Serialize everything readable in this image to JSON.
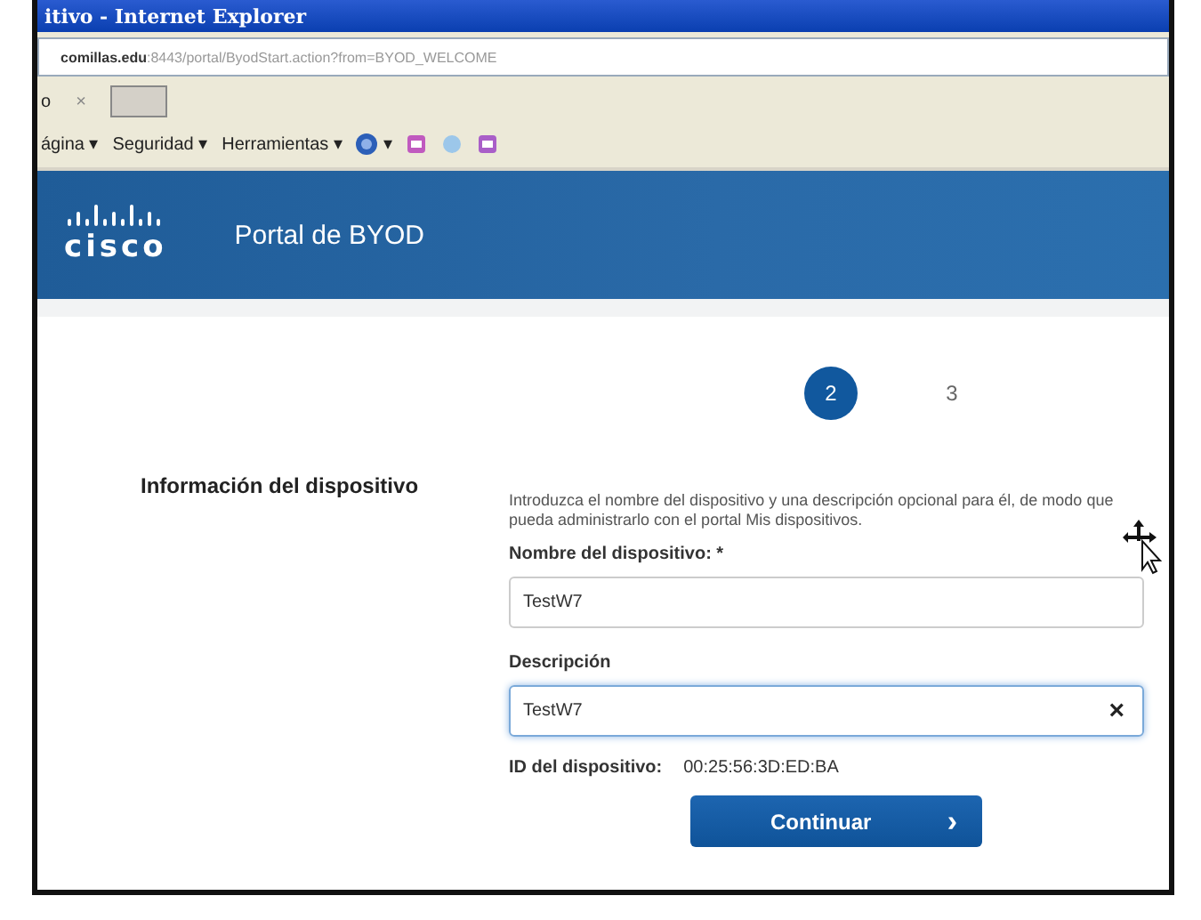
{
  "window": {
    "title": "itivo - Internet Explorer"
  },
  "address_bar": {
    "host": "comillas.edu",
    "path": ":8443/portal/ByodStart.action?from=BYOD_WELCOME"
  },
  "tab_row": {
    "label": "o",
    "close": "×"
  },
  "command_bar": {
    "menus": [
      {
        "label": "ágina",
        "arrow": "▾"
      },
      {
        "label": "Seguridad",
        "arrow": "▾"
      },
      {
        "label": "Herramientas",
        "arrow": "▾"
      }
    ],
    "help_arrow": "▾"
  },
  "header": {
    "logo_text": "cisco",
    "title": "Portal de BYOD"
  },
  "steps": [
    {
      "label": "2",
      "selected": true
    },
    {
      "label": "3",
      "selected": false
    }
  ],
  "section_title": "Información del dispositivo",
  "intro": "Introduzca el nombre del dispositivo y una descripción opcional para él, de modo que pueda administrarlo con el portal Mis dispositivos.",
  "fields": [
    {
      "label": "Nombre del dispositivo: *",
      "value": "TestW7",
      "focused": false
    },
    {
      "label": "Descripción",
      "value": "TestW7",
      "focused": true,
      "clear": "×"
    }
  ],
  "device_id": {
    "label": "ID del dispositivo:",
    "value": "00:25:56:3D:ED:BA"
  },
  "button": {
    "label": "Continuar",
    "arrow": "›"
  }
}
